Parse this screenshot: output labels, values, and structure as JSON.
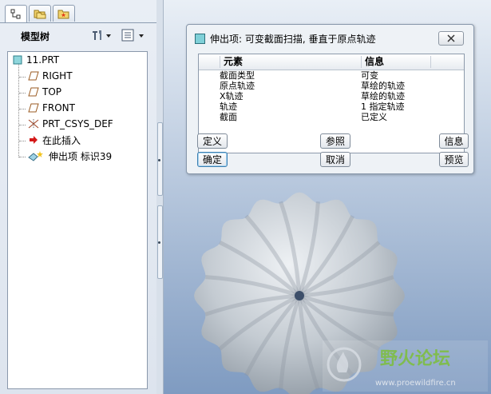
{
  "left_panel": {
    "tabs": [
      {
        "icon": "model-tree-tab-icon"
      },
      {
        "icon": "folder-browser-tab-icon"
      },
      {
        "icon": "favorites-tab-icon"
      }
    ],
    "tree_title": "模型树",
    "tree_tools": [
      {
        "icon": "settings-tools-icon"
      },
      {
        "icon": "show-options-icon"
      }
    ],
    "tree_nodes": [
      {
        "label": "11.PRT",
        "icon": "part-icon"
      },
      {
        "label": "RIGHT",
        "icon": "datum-plane-icon"
      },
      {
        "label": "TOP",
        "icon": "datum-plane-icon"
      },
      {
        "label": "FRONT",
        "icon": "datum-plane-icon"
      },
      {
        "label": "PRT_CSYS_DEF",
        "icon": "coordinate-system-icon"
      },
      {
        "label": "在此插入",
        "icon": "insert-here-arrow-icon"
      },
      {
        "label": "伸出项 标识39",
        "icon": "variable-sweep-feature-icon"
      }
    ]
  },
  "dialog": {
    "title": "伸出项: 可变截面扫描, 垂直于原点轨迹",
    "close_icon": "close-icon",
    "columns": [
      "元素",
      "信息"
    ],
    "rows": [
      {
        "element": "截面类型",
        "info": "可变"
      },
      {
        "element": "原点轨迹",
        "info": "草绘的轨迹"
      },
      {
        "element": "X轨迹",
        "info": "草绘的轨迹"
      },
      {
        "element": "轨迹",
        "info": "1 指定轨迹"
      },
      {
        "element": "截面",
        "info": "已定义"
      }
    ],
    "buttons": {
      "define": "定义",
      "reference": "参照",
      "info": "信息",
      "ok": "确定",
      "cancel": "取消",
      "preview": "预览"
    }
  },
  "watermark": {
    "text": "野火论坛",
    "url": "www.proewildfire.cn"
  },
  "colors": {
    "graphics_top": "#e9eff6",
    "graphics_bottom": "#7f9bc1",
    "model_surface": "#c9d0d6",
    "watermark_green": "#7cbf3a"
  }
}
